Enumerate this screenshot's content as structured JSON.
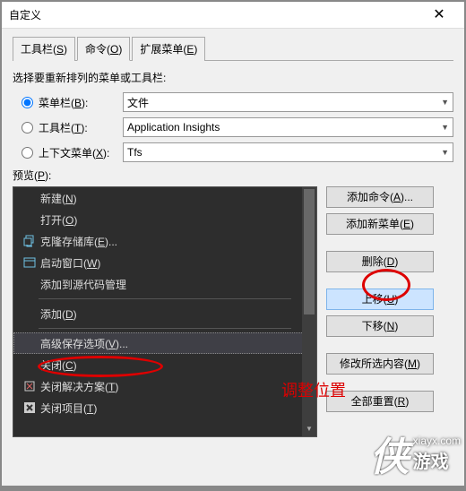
{
  "window": {
    "title": "自定义"
  },
  "tabs": {
    "toolbar": {
      "label": "工具栏(",
      "key": "S",
      "suffix": ")"
    },
    "commands": {
      "label": "命令(",
      "key": "O",
      "suffix": ")"
    },
    "extensions": {
      "label": "扩展菜单(",
      "key": "E",
      "suffix": ")"
    }
  },
  "section_label": "选择要重新排列的菜单或工具栏:",
  "radios": {
    "menubar": {
      "label": "菜单栏(",
      "key": "B",
      "suffix": "):",
      "value": "文件"
    },
    "toolbar": {
      "label": "工具栏(",
      "key": "T",
      "suffix": "):",
      "value": "Application Insights"
    },
    "context": {
      "label": "上下文菜单(",
      "key": "X",
      "suffix": "):",
      "value": "Tfs"
    }
  },
  "preview": {
    "label": "预览(",
    "key": "P",
    "suffix": "):"
  },
  "menu_items": [
    {
      "icon": "",
      "label": "新建(",
      "key": "N",
      "suffix": ")",
      "sub": true
    },
    {
      "icon": "",
      "label": "打开(",
      "key": "O",
      "suffix": ")",
      "sub": true
    },
    {
      "icon": "clone",
      "label": "克隆存储库(",
      "key": "E",
      "suffix": ")..."
    },
    {
      "icon": "window",
      "label": "启动窗口(",
      "key": "W",
      "suffix": ")"
    },
    {
      "icon": "",
      "label": "添加到源代码管理"
    },
    {
      "sep": true
    },
    {
      "icon": "",
      "label": "添加(",
      "key": "D",
      "suffix": ")",
      "sub": true
    },
    {
      "sep": true
    },
    {
      "icon": "",
      "label": "高级保存选项(",
      "key": "V",
      "suffix": ")...",
      "selected": true
    },
    {
      "icon": "",
      "label": "关闭(",
      "key": "C",
      "suffix": ")"
    },
    {
      "icon": "close-sol",
      "label": "关闭解决方案(",
      "key": "T",
      "suffix": ")"
    },
    {
      "icon": "close-file",
      "label": "关闭项目(",
      "key": "T",
      "suffix": ")"
    }
  ],
  "buttons": {
    "add_cmd": {
      "label": "添加命令(",
      "key": "A",
      "suffix": ")..."
    },
    "add_menu": {
      "label": "添加新菜单(",
      "key": "E",
      "suffix": ")"
    },
    "delete": {
      "label": "删除(",
      "key": "D",
      "suffix": ")"
    },
    "move_up": {
      "label": "上移(",
      "key": "U",
      "suffix": ")"
    },
    "move_down": {
      "label": "下移(",
      "key": "N",
      "suffix": ")"
    },
    "modify": {
      "label": "修改所选内容(",
      "key": "M",
      "suffix": ")"
    },
    "reset": {
      "label": "全部重置(",
      "key": "R",
      "suffix": ")"
    }
  },
  "annotation": "调整位置",
  "watermark": {
    "site": "xiayx.com",
    "brand": "游戏"
  }
}
